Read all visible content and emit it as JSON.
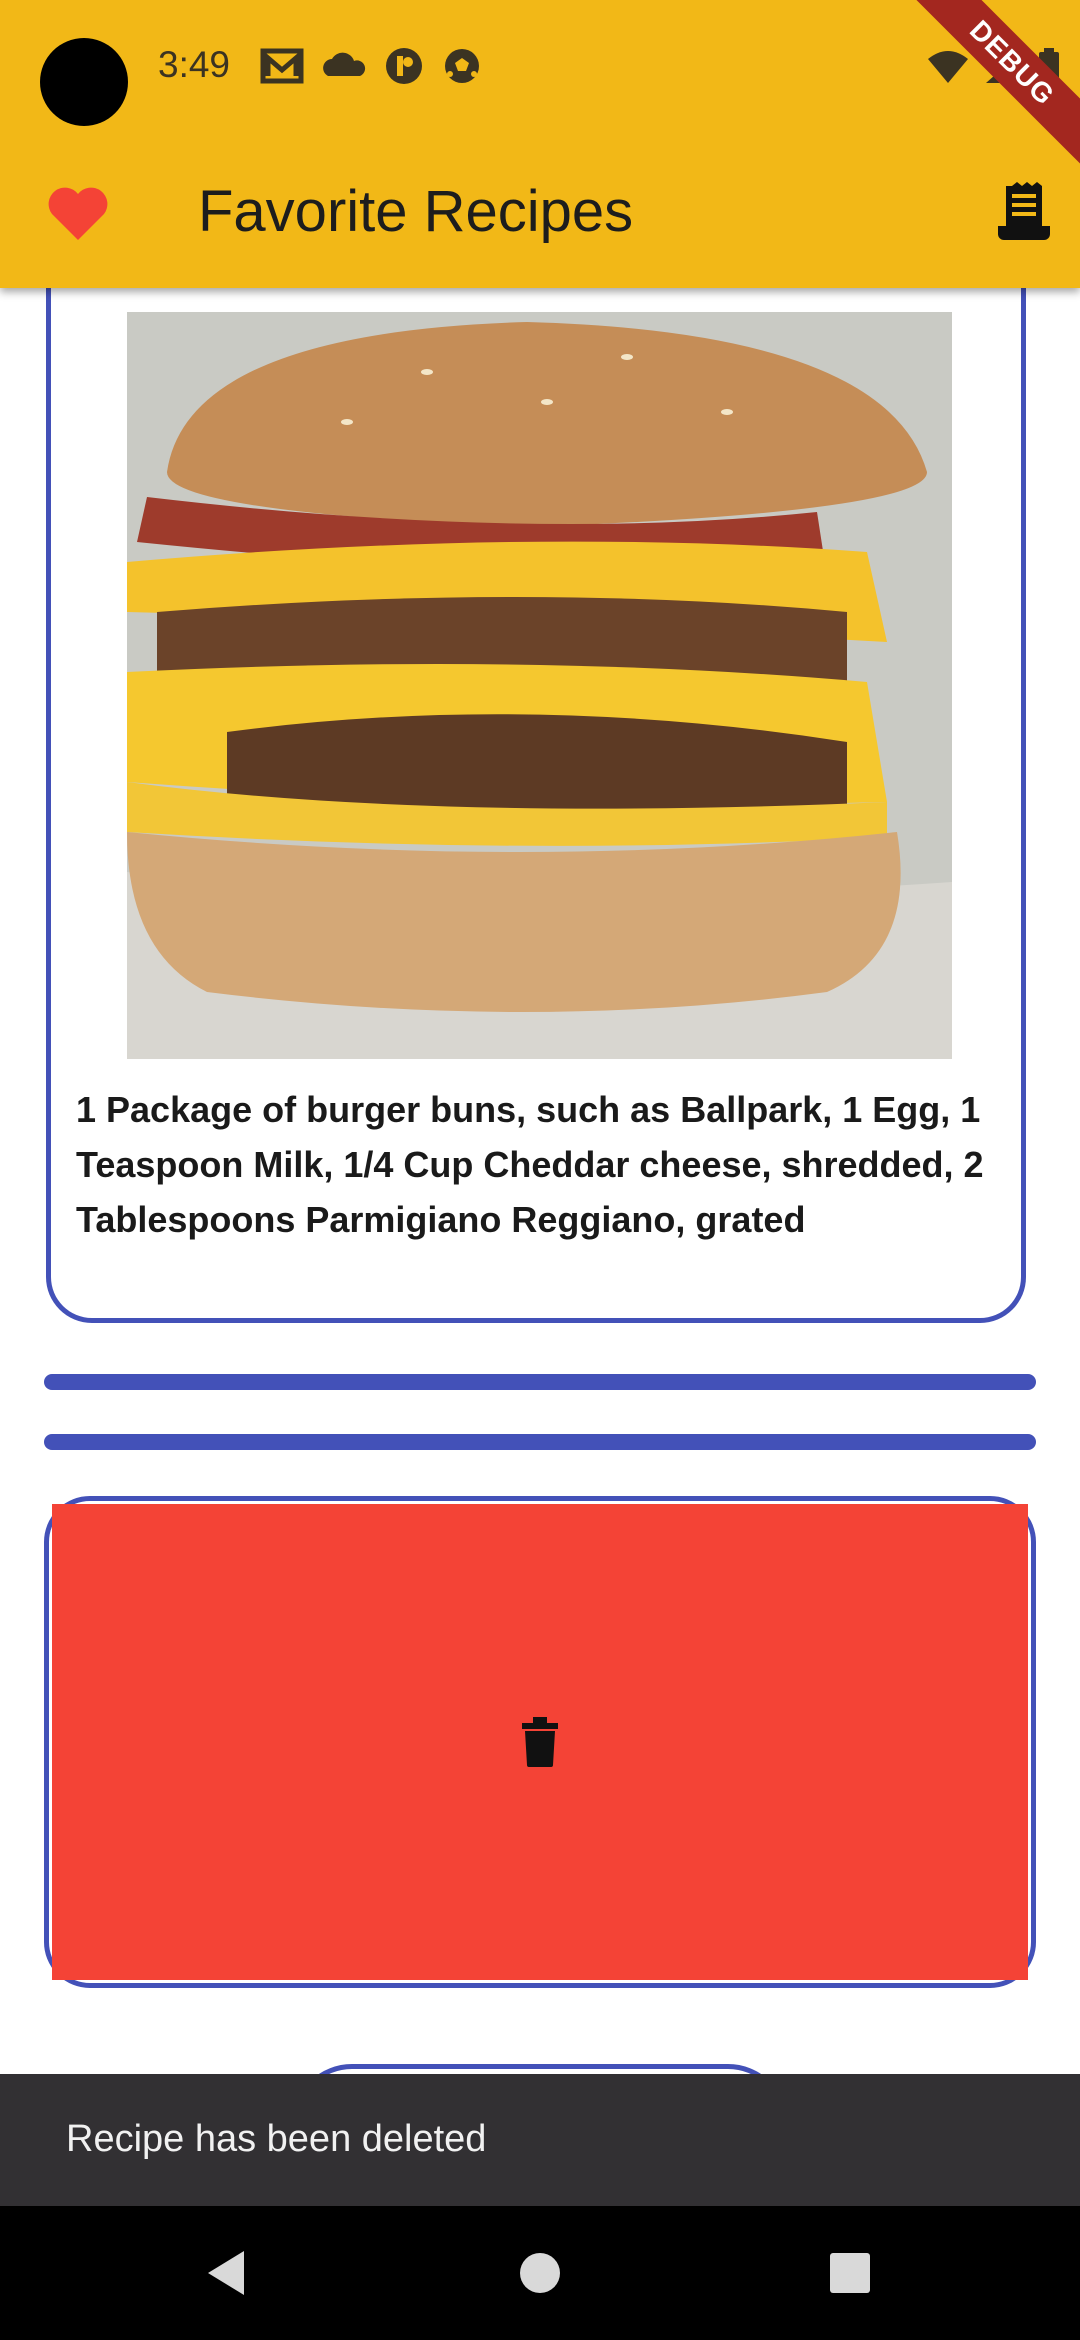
{
  "status_bar": {
    "time": "3:49",
    "icons": [
      "gmail-icon",
      "cloud-icon",
      "app-icon",
      "soccer-icon",
      "wifi-icon",
      "signal-icon",
      "battery-icon"
    ]
  },
  "debug_banner": "DEBUG",
  "app_bar": {
    "title": "Favorite Recipes",
    "leading_icon": "heart-icon",
    "trailing_icon": "receipt-icon"
  },
  "recipe_card": {
    "image": "burger-photo",
    "ingredients": "1 Package of burger buns, such as Ballpark, 1 Egg, 1 Teaspoon Milk, 1/4 Cup Cheddar cheese, shredded, 2 Tablespoons Parmigiano Reggiano, grated"
  },
  "dismiss_card": {
    "icon": "trash-icon",
    "background_color": "#f44336"
  },
  "snackbar": {
    "message": "Recipe has been deleted"
  },
  "colors": {
    "app_bar": "#f2b817",
    "accent": "#4351b8",
    "heart": "#f44336",
    "snackbar": "#323033"
  }
}
